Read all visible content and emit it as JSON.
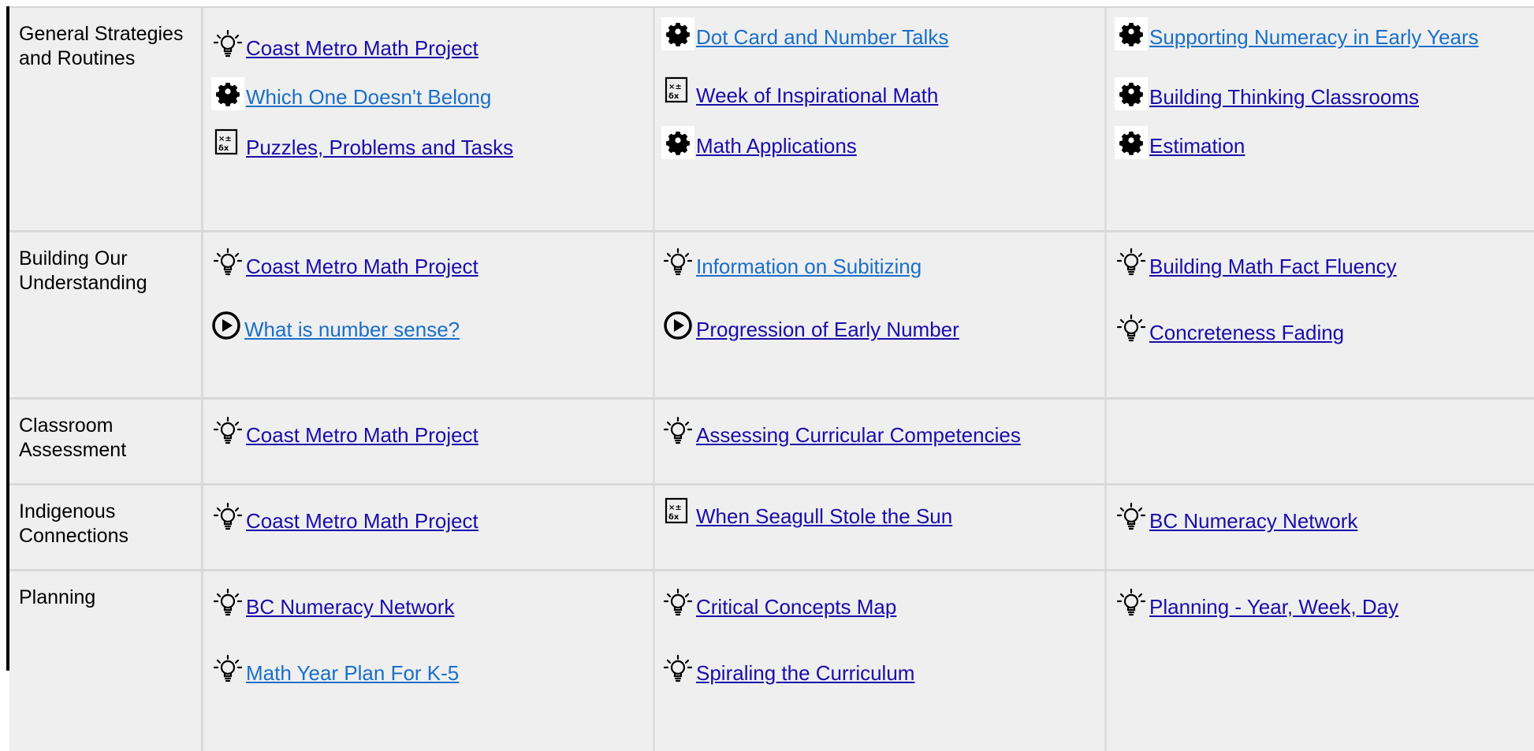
{
  "colors": {
    "link_dark": "#1a0dab",
    "link_light": "#1a6fc9",
    "cell_bg": "#efefef",
    "divider": "#d9d9d9"
  },
  "rows": [
    {
      "label": "General Strategies and Routines",
      "columns": [
        [
          {
            "icon": "lightbulb-icon",
            "text": "Coast Metro Math Project"
          },
          {
            "icon": "gear-icon",
            "text": "Which One Doesn't Belong"
          },
          {
            "icon": "calculator-icon",
            "text": "Puzzles, Problems and Tasks"
          }
        ],
        [
          {
            "icon": "gear-icon",
            "text": "Dot Card and Number Talks"
          },
          {
            "icon": "calculator-icon",
            "text": "Week of Inspirational Math"
          },
          {
            "icon": "gear-icon",
            "text": "Math Applications"
          }
        ],
        [
          {
            "icon": "gear-icon",
            "text": "Supporting Numeracy in Early Years"
          },
          {
            "icon": "gear-icon",
            "text": "Building Thinking Classrooms"
          },
          {
            "icon": "gear-icon",
            "text": "Estimation"
          }
        ]
      ]
    },
    {
      "label": "Building Our Understanding",
      "columns": [
        [
          {
            "icon": "lightbulb-icon",
            "text": "Coast Metro Math Project"
          },
          {
            "icon": "play-circle-icon",
            "text": "What is number sense?"
          }
        ],
        [
          {
            "icon": "lightbulb-icon",
            "text": "Information on Subitizing"
          },
          {
            "icon": "play-circle-icon",
            "text": "Progression of Early Number"
          }
        ],
        [
          {
            "icon": "lightbulb-icon",
            "text": "Building Math Fact Fluency"
          },
          {
            "icon": "lightbulb-icon",
            "text": "Concreteness Fading"
          }
        ]
      ]
    },
    {
      "label": "Classroom Assessment",
      "columns": [
        [
          {
            "icon": "lightbulb-icon",
            "text": "Coast Metro Math Project"
          }
        ],
        [
          {
            "icon": "lightbulb-icon",
            "text": "Assessing Curricular Competencies"
          }
        ],
        []
      ]
    },
    {
      "label": "Indigenous Connections",
      "columns": [
        [
          {
            "icon": "lightbulb-icon",
            "text": "Coast Metro Math Project"
          }
        ],
        [
          {
            "icon": "calculator-icon",
            "text": "When Seagull Stole the Sun"
          }
        ],
        [
          {
            "icon": "lightbulb-icon",
            "text": "BC Numeracy Network"
          }
        ]
      ]
    },
    {
      "label": "Planning",
      "columns": [
        [
          {
            "icon": "lightbulb-icon",
            "text": "BC Numeracy Network"
          },
          {
            "icon": "lightbulb-icon",
            "text": "Math Year Plan For K-5"
          }
        ],
        [
          {
            "icon": "lightbulb-icon",
            "text": "Critical Concepts Map"
          },
          {
            "icon": "lightbulb-icon",
            "text": "Spiraling the Curriculum"
          }
        ],
        [
          {
            "icon": "lightbulb-icon",
            "text": "Planning - Year, Week, Day"
          }
        ]
      ]
    }
  ]
}
